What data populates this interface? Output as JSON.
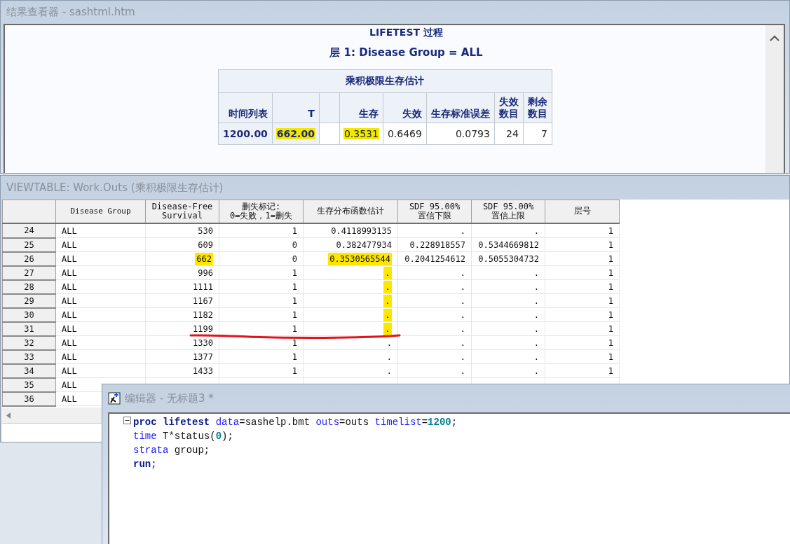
{
  "results_window": {
    "title": "结果查看器 - sashtml.htm",
    "procedure_title": "LIFETEST 过程",
    "stratum_title": "层 1: Disease Group = ALL",
    "table": {
      "caption": "乘积极限生存估计",
      "columns": [
        {
          "label": "时间列表",
          "kind": "rowheader"
        },
        {
          "label": "T",
          "kind": "rowheader"
        },
        {
          "kind": "spacer"
        },
        {
          "label": "生存",
          "kind": "data"
        },
        {
          "label": "失效",
          "kind": "data"
        },
        {
          "label": "生存标准误差",
          "kind": "data"
        },
        {
          "label": "失效数目",
          "kind": "stacked"
        },
        {
          "label": "剩余数目",
          "kind": "stacked"
        }
      ],
      "row": [
        {
          "text": "1200.00",
          "highlighted": false
        },
        {
          "text": "662.00",
          "highlighted": true
        },
        {
          "text": "0.3531",
          "highlighted": true
        },
        {
          "text": "0.6469",
          "highlighted": false
        },
        {
          "text": "0.0793",
          "highlighted": false
        },
        {
          "text": "24",
          "highlighted": false
        },
        {
          "text": "7",
          "highlighted": false
        }
      ]
    }
  },
  "viewtable_window": {
    "title": "VIEWTABLE: Work.Outs (乘积极限生存估计)",
    "columns": [
      "Disease Group",
      "Disease-Free\nSurvival",
      "删失标记:\n0=失败，1=删失",
      "生存分布函数估计",
      "SDF 95.00%\n置信下限",
      "SDF 95.00%\n置信上限",
      "层号"
    ],
    "rows": [
      {
        "n": "24",
        "underlined": false,
        "cells": [
          {
            "text": "ALL",
            "highlighted": false
          },
          {
            "text": "530",
            "highlighted": false
          },
          {
            "text": "1",
            "highlighted": false
          },
          {
            "text": "0.4118993135",
            "highlighted": false
          },
          {
            "text": ".",
            "highlighted": false
          },
          {
            "text": ".",
            "highlighted": false
          },
          {
            "text": "1",
            "highlighted": false
          }
        ]
      },
      {
        "n": "25",
        "underlined": false,
        "cells": [
          {
            "text": "ALL",
            "highlighted": false
          },
          {
            "text": "609",
            "highlighted": false
          },
          {
            "text": "0",
            "highlighted": false
          },
          {
            "text": "0.382477934",
            "highlighted": false
          },
          {
            "text": "0.228918557",
            "highlighted": false
          },
          {
            "text": "0.5344669812",
            "highlighted": false
          },
          {
            "text": "1",
            "highlighted": false
          }
        ]
      },
      {
        "n": "26",
        "underlined": false,
        "cells": [
          {
            "text": "ALL",
            "highlighted": false
          },
          {
            "text": "662",
            "highlighted": true
          },
          {
            "text": "0",
            "highlighted": false
          },
          {
            "text": "0.3530565544",
            "highlighted": true
          },
          {
            "text": "0.2041254612",
            "highlighted": false
          },
          {
            "text": "0.5055304732",
            "highlighted": false
          },
          {
            "text": "1",
            "highlighted": false
          }
        ]
      },
      {
        "n": "27",
        "underlined": false,
        "cells": [
          {
            "text": "ALL",
            "highlighted": false
          },
          {
            "text": "996",
            "highlighted": false
          },
          {
            "text": "1",
            "highlighted": false
          },
          {
            "text": ".",
            "highlighted": true
          },
          {
            "text": ".",
            "highlighted": false
          },
          {
            "text": ".",
            "highlighted": false
          },
          {
            "text": "1",
            "highlighted": false
          }
        ]
      },
      {
        "n": "28",
        "underlined": false,
        "cells": [
          {
            "text": "ALL",
            "highlighted": false
          },
          {
            "text": "1111",
            "highlighted": false
          },
          {
            "text": "1",
            "highlighted": false
          },
          {
            "text": ".",
            "highlighted": true
          },
          {
            "text": ".",
            "highlighted": false
          },
          {
            "text": ".",
            "highlighted": false
          },
          {
            "text": "1",
            "highlighted": false
          }
        ]
      },
      {
        "n": "29",
        "underlined": false,
        "cells": [
          {
            "text": "ALL",
            "highlighted": false
          },
          {
            "text": "1167",
            "highlighted": false
          },
          {
            "text": "1",
            "highlighted": false
          },
          {
            "text": ".",
            "highlighted": true
          },
          {
            "text": ".",
            "highlighted": false
          },
          {
            "text": ".",
            "highlighted": false
          },
          {
            "text": "1",
            "highlighted": false
          }
        ]
      },
      {
        "n": "30",
        "underlined": false,
        "cells": [
          {
            "text": "ALL",
            "highlighted": false
          },
          {
            "text": "1182",
            "highlighted": false
          },
          {
            "text": "1",
            "highlighted": false
          },
          {
            "text": ".",
            "highlighted": true
          },
          {
            "text": ".",
            "highlighted": false
          },
          {
            "text": ".",
            "highlighted": false
          },
          {
            "text": "1",
            "highlighted": false
          }
        ]
      },
      {
        "n": "31",
        "underlined": true,
        "cells": [
          {
            "text": "ALL",
            "highlighted": false
          },
          {
            "text": "1199",
            "highlighted": false
          },
          {
            "text": "1",
            "highlighted": false
          },
          {
            "text": ".",
            "highlighted": true
          },
          {
            "text": ".",
            "highlighted": false
          },
          {
            "text": ".",
            "highlighted": false
          },
          {
            "text": "1",
            "highlighted": false
          }
        ]
      },
      {
        "n": "32",
        "underlined": false,
        "cells": [
          {
            "text": "ALL",
            "highlighted": false
          },
          {
            "text": "1330",
            "highlighted": false
          },
          {
            "text": "1",
            "highlighted": false
          },
          {
            "text": ".",
            "highlighted": false
          },
          {
            "text": ".",
            "highlighted": false
          },
          {
            "text": ".",
            "highlighted": false
          },
          {
            "text": "1",
            "highlighted": false
          }
        ]
      },
      {
        "n": "33",
        "underlined": false,
        "cells": [
          {
            "text": "ALL",
            "highlighted": false
          },
          {
            "text": "1377",
            "highlighted": false
          },
          {
            "text": "1",
            "highlighted": false
          },
          {
            "text": ".",
            "highlighted": false
          },
          {
            "text": ".",
            "highlighted": false
          },
          {
            "text": ".",
            "highlighted": false
          },
          {
            "text": "1",
            "highlighted": false
          }
        ]
      },
      {
        "n": "34",
        "underlined": false,
        "cells": [
          {
            "text": "ALL",
            "highlighted": false
          },
          {
            "text": "1433",
            "highlighted": false
          },
          {
            "text": "1",
            "highlighted": false
          },
          {
            "text": ".",
            "highlighted": false
          },
          {
            "text": ".",
            "highlighted": false
          },
          {
            "text": ".",
            "highlighted": false
          },
          {
            "text": "1",
            "highlighted": false
          }
        ]
      },
      {
        "n": "35",
        "cells": [
          {
            "text": "ALL"
          }
        ]
      },
      {
        "n": "36",
        "cells": [
          {
            "text": "ALL"
          }
        ]
      }
    ]
  },
  "editor_window": {
    "title": "编辑器 - 无标题3 *",
    "lines": [
      {
        "fold": true,
        "tokens": [
          {
            "text": "proc lifetest ",
            "kind": "keyword"
          },
          {
            "text": "data",
            "kind": "option"
          },
          {
            "text": "=sashelp.bmt ",
            "kind": "plain"
          },
          {
            "text": "outs",
            "kind": "option"
          },
          {
            "text": "=outs ",
            "kind": "plain"
          },
          {
            "text": "timelist",
            "kind": "option"
          },
          {
            "text": "=",
            "kind": "plain"
          },
          {
            "text": "1200",
            "kind": "number"
          },
          {
            "text": ";",
            "kind": "plain"
          }
        ]
      },
      {
        "fold": false,
        "tokens": [
          {
            "text": "time",
            "kind": "option"
          },
          {
            "text": " T*status(",
            "kind": "plain"
          },
          {
            "text": "0",
            "kind": "number"
          },
          {
            "text": ");",
            "kind": "plain"
          }
        ]
      },
      {
        "fold": false,
        "tokens": [
          {
            "text": "strata",
            "kind": "option"
          },
          {
            "text": " group;",
            "kind": "plain"
          }
        ]
      },
      {
        "fold": false,
        "tokens": [
          {
            "text": "run",
            "kind": "keyword"
          },
          {
            "text": ";",
            "kind": "plain"
          }
        ]
      }
    ]
  }
}
